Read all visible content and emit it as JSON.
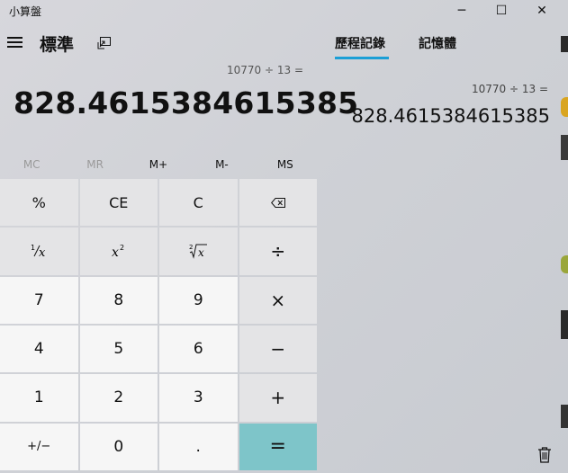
{
  "app": {
    "title": "小算盤"
  },
  "window_controls": {
    "minimize": "─",
    "maximize": "☐",
    "close": "✕"
  },
  "header": {
    "mode": "標準"
  },
  "display": {
    "expression": "10770 ÷ 13 =",
    "value": "828.4615384615385"
  },
  "memory": {
    "mc": "MC",
    "mr": "MR",
    "mplus": "M+",
    "mminus": "M-",
    "ms": "MS"
  },
  "keys": {
    "percent": "%",
    "ce": "CE",
    "clear": "C",
    "backspace": "⌫",
    "divide": "÷",
    "multiply": "×",
    "subtract": "−",
    "add": "+",
    "negate": "+/−",
    "decimal": ".",
    "equals": "=",
    "n0": "0",
    "n1": "1",
    "n2": "2",
    "n3": "3",
    "n4": "4",
    "n5": "5",
    "n6": "6",
    "n7": "7",
    "n8": "8",
    "n9": "9"
  },
  "panel": {
    "tab_history": "歷程記錄",
    "tab_memory": "記憶體",
    "history": [
      {
        "expression": "10770   ÷   13 =",
        "result": "828.4615384615385"
      }
    ]
  }
}
